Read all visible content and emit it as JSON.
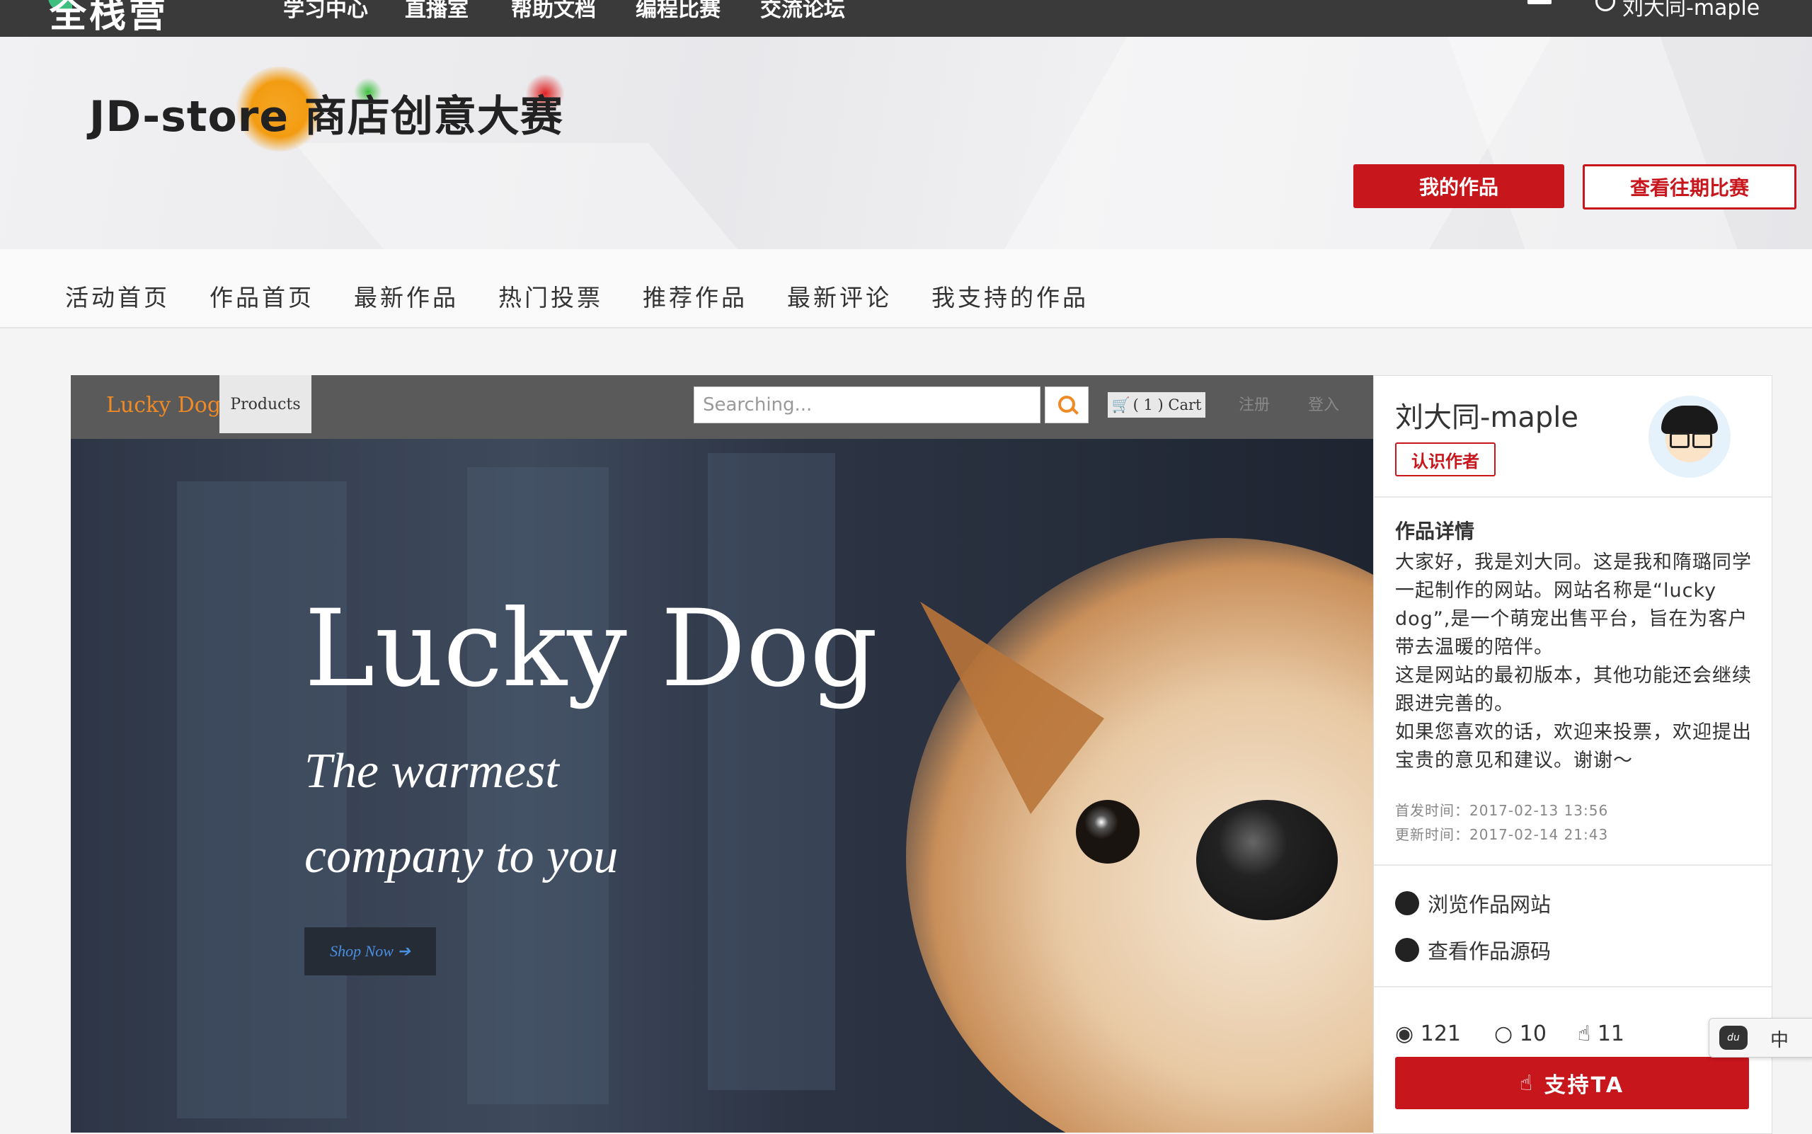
{
  "topbar": {
    "logo": "全栈营",
    "nav": [
      "学习中心",
      "直播室",
      "帮助文档",
      "编程比赛",
      "交流论坛"
    ],
    "user_name": "刘大同-maple"
  },
  "banner": {
    "title": "JD-store 商店创意大赛",
    "my_works_button": "我的作品",
    "past_contests_button": "查看往期比赛"
  },
  "subnav": {
    "items": [
      "活动首页",
      "作品首页",
      "最新作品",
      "热门投票",
      "推荐作品",
      "最新评论",
      "我支持的作品"
    ]
  },
  "work_screenshot": {
    "brand": "Lucky Dog",
    "products_tab": "Products",
    "search_placeholder": "Searching...",
    "cart": "( 1 ) Cart",
    "register": "注册",
    "login": "登入",
    "hero_title": "Lucky Dog",
    "hero_sub_line1": "The warmest",
    "hero_sub_line2": "company to you",
    "shop_button": "Shop Now"
  },
  "card": {
    "author": "刘大同-maple",
    "know_author_button": "认识作者",
    "detail_title": "作品详情",
    "description": [
      "大家好，我是刘大同。这是我和隋璐同学一起制作的网站。网站名称是“lucky dog”,是一个萌宠出售平台，旨在为客户带去温暖的陪伴。",
      "这是网站的最初版本，其他功能还会继续跟进完善的。",
      "如果您喜欢的话，欢迎来投票，欢迎提出宝贵的意见和建议。谢谢～"
    ],
    "published": "首发时间：2017-02-13 13:56",
    "updated": "更新时间：2017-02-14 21:43",
    "browse_site": "浏览作品网站",
    "view_source": "查看作品源码",
    "views": "121",
    "comments": "10",
    "likes": "11",
    "support_button": "支持TA"
  },
  "ime": {
    "label": "中",
    "icon": "baidu-paw-icon"
  },
  "colors": {
    "accent": "#c8161d",
    "topbar": "#3a3a3a",
    "brand_orange": "#f08a24"
  }
}
